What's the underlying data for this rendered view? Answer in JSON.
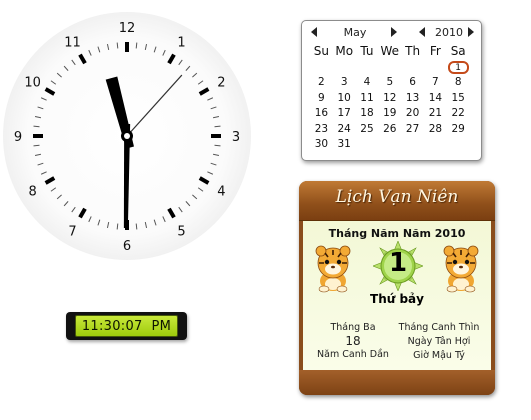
{
  "analog_clock": {
    "numbers": [
      "12",
      "1",
      "2",
      "3",
      "4",
      "5",
      "6",
      "7",
      "8",
      "9",
      "10",
      "11"
    ],
    "time": {
      "hour": 11,
      "minute": 30,
      "second": 7
    }
  },
  "digital_clock": {
    "time_text": "11:30:07  PM"
  },
  "calendar": {
    "month": "May",
    "year": "2010",
    "weekdays": [
      "Su",
      "Mo",
      "Tu",
      "We",
      "Th",
      "Fr",
      "Sa"
    ],
    "weeks": [
      [
        "",
        "",
        "",
        "",
        "",
        "",
        "1"
      ],
      [
        "2",
        "3",
        "4",
        "5",
        "6",
        "7",
        "8"
      ],
      [
        "9",
        "10",
        "11",
        "12",
        "13",
        "14",
        "15"
      ],
      [
        "16",
        "17",
        "18",
        "19",
        "20",
        "21",
        "22"
      ],
      [
        "23",
        "24",
        "25",
        "26",
        "27",
        "28",
        "29"
      ],
      [
        "30",
        "31",
        "",
        "",
        "",
        "",
        ""
      ]
    ],
    "today": "1"
  },
  "lunar": {
    "title": "Lịch Vạn Niên",
    "month_year": "Tháng Năm Năm 2010",
    "day": "1",
    "weekday": "Thứ bảy",
    "lunar_month": "Tháng Ba",
    "lunar_day": "18",
    "lunar_year": "Năm Canh Dần",
    "month_canchi": "Tháng Canh Thìn",
    "day_canchi": "Ngày Tân Hợi",
    "hour_canchi": "Giờ Mậu Tý"
  },
  "colors": {
    "today_ring": "#c44a1a",
    "lcd_background": "#b4da22",
    "lunar_frame": "#8a4d1c",
    "lunar_body": "#f5f9dc",
    "day_badge": "#9fd34a"
  },
  "icons": {
    "calendar_nav": "triangle-arrows",
    "lunar_decoration": "tiger-cartoon",
    "day_badge": "green-sun-badge"
  }
}
